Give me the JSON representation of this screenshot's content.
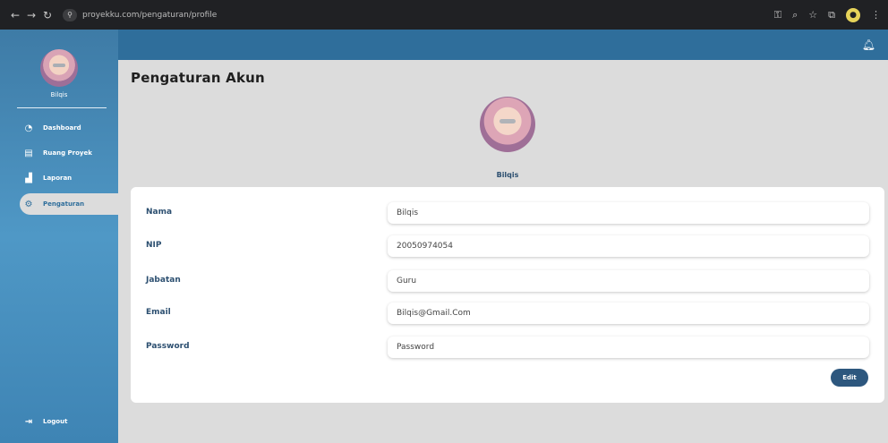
{
  "browser": {
    "url": "proyekku.com/pengaturan/profile"
  },
  "sidebar": {
    "user_name": "Bilqis",
    "items": [
      {
        "label": "Dashboard",
        "icon": "dashboard-icon"
      },
      {
        "label": "Ruang Proyek",
        "icon": "file-icon"
      },
      {
        "label": "Laporan",
        "icon": "chart-icon"
      },
      {
        "label": "Pengaturan",
        "icon": "gear-icon",
        "active": true
      }
    ],
    "logout_label": "Logout"
  },
  "page": {
    "title": "Pengaturan Akun",
    "profile_name": "Bilqis"
  },
  "form": {
    "fields": [
      {
        "label": "Nama",
        "value": "Bilqis"
      },
      {
        "label": "NIP",
        "value": "20050974054"
      },
      {
        "label": "Jabatan",
        "value": "Guru"
      },
      {
        "label": "Email",
        "value": "Bilqis@Gmail.Com"
      },
      {
        "label": "Password",
        "value": "Password"
      }
    ],
    "edit_label": "Edit"
  },
  "colors": {
    "topbar": "#2f6e9b",
    "sidebar": "#4f98c6",
    "label": "#2c4f70",
    "edit_button": "#2d577e"
  }
}
